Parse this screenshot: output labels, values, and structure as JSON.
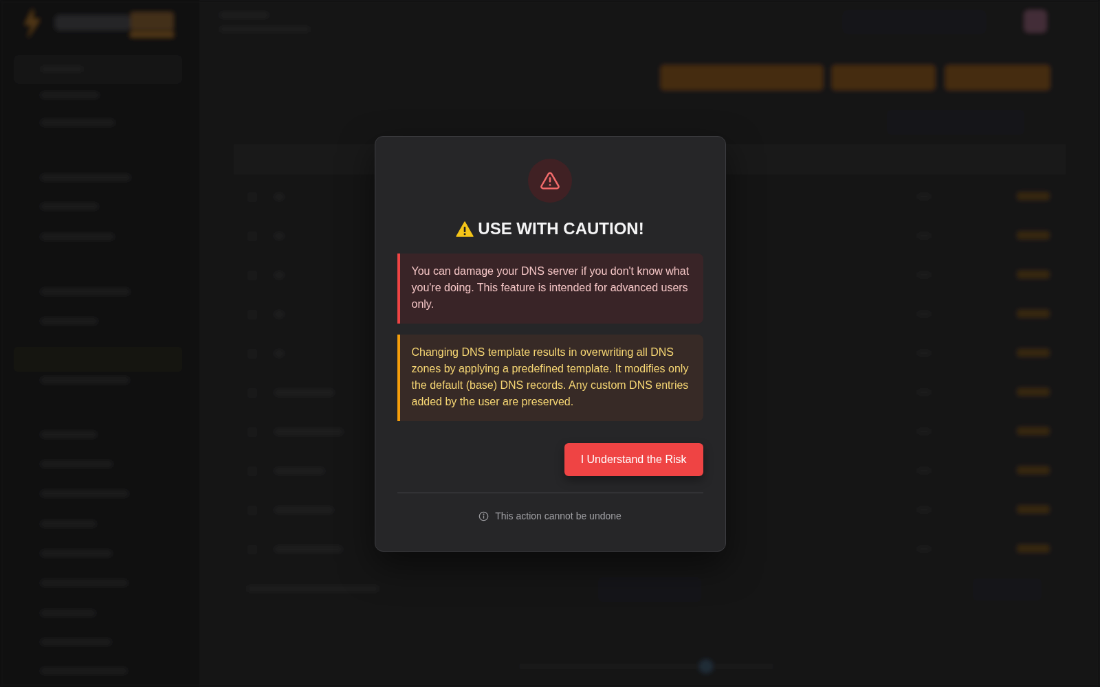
{
  "dialog": {
    "title": "USE WITH CAUTION!",
    "alerts": [
      {
        "kind": "danger",
        "text": "You can damage your DNS server if you don't know what you're doing. This feature is intended for advanced users only."
      },
      {
        "kind": "warning",
        "text": "Changing DNS template results in overwriting all DNS zones by applying a predefined template. It modifies only the default (base) DNS records. Any custom DNS entries added by the user are preserved."
      }
    ],
    "confirm_button": "I Understand the Risk",
    "footer_note": "This action cannot be undone"
  }
}
